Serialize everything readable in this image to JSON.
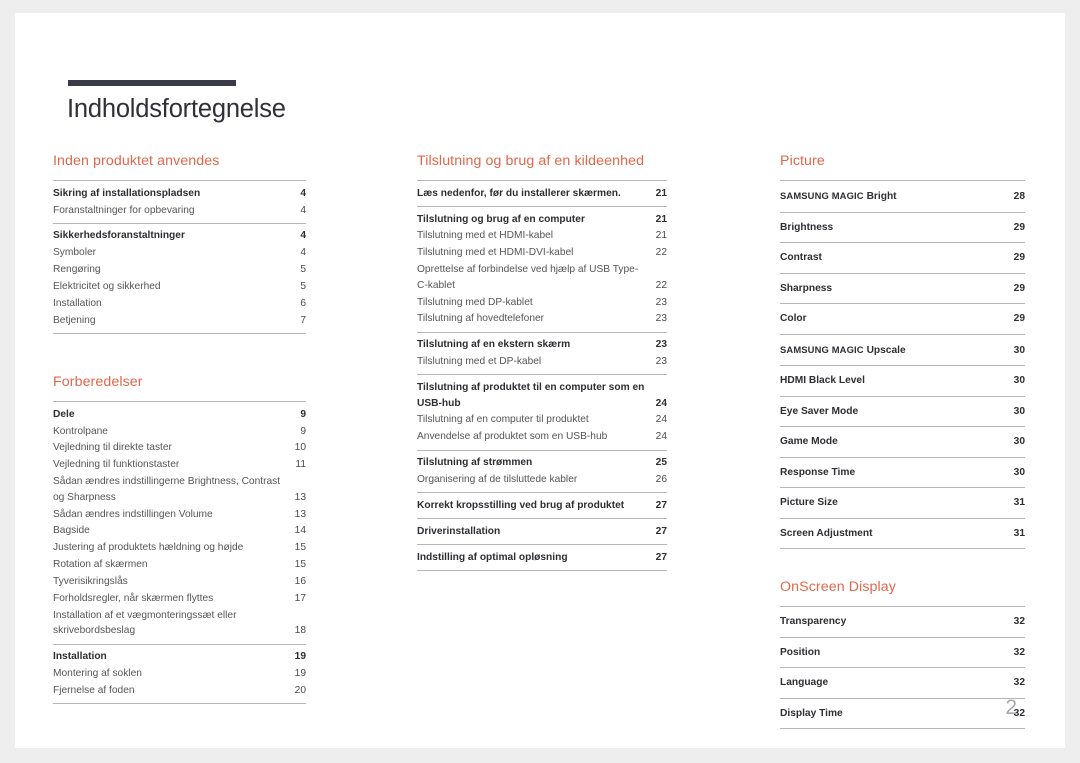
{
  "document": {
    "title": "Indholdsfortegnelse",
    "page_number": "2",
    "accent_color": "#e2674a",
    "rule_color": "#3b3b47"
  },
  "columns": [
    {
      "sections": [
        {
          "heading": "Inden produktet anvendes",
          "groups": [
            {
              "entries": [
                {
                  "label": "Sikring af installationspladsen",
                  "page": "4",
                  "level": 1
                },
                {
                  "label": "Foranstaltninger for opbevaring",
                  "page": "4",
                  "level": 2
                }
              ]
            },
            {
              "entries": [
                {
                  "label": "Sikkerhedsforanstaltninger",
                  "page": "4",
                  "level": 1
                },
                {
                  "label": "Symboler",
                  "page": "4",
                  "level": 2
                },
                {
                  "label": "Rengøring",
                  "page": "5",
                  "level": 2
                },
                {
                  "label": "Elektricitet og sikkerhed",
                  "page": "5",
                  "level": 2
                },
                {
                  "label": "Installation",
                  "page": "6",
                  "level": 2
                },
                {
                  "label": "Betjening",
                  "page": "7",
                  "level": 2
                }
              ]
            }
          ]
        },
        {
          "heading": "Forberedelser",
          "groups": [
            {
              "entries": [
                {
                  "label": "Dele",
                  "page": "9",
                  "level": 1
                },
                {
                  "label": "Kontrolpane",
                  "page": "9",
                  "level": 2
                },
                {
                  "label": "Vejledning til direkte taster",
                  "page": "10",
                  "level": 2
                },
                {
                  "label": "Vejledning til funktionstaster",
                  "page": "11",
                  "level": 2
                },
                {
                  "label": "Sådan ændres indstillingerne Brightness, Contrast og Sharpness",
                  "page": "13",
                  "level": 2
                },
                {
                  "label": "Sådan ændres indstillingen Volume",
                  "page": "13",
                  "level": 2
                },
                {
                  "label": "Bagside",
                  "page": "14",
                  "level": 2
                },
                {
                  "label": "Justering af produktets hældning og højde",
                  "page": "15",
                  "level": 2
                },
                {
                  "label": "Rotation af skærmen",
                  "page": "15",
                  "level": 2
                },
                {
                  "label": "Tyverisikringslås",
                  "page": "16",
                  "level": 2
                },
                {
                  "label": "Forholdsregler, når skærmen flyttes",
                  "page": "17",
                  "level": 2
                },
                {
                  "label": "Installation af et vægmonteringssæt eller skrivebordsbeslag",
                  "page": "18",
                  "level": 2
                }
              ]
            },
            {
              "entries": [
                {
                  "label": "Installation",
                  "page": "19",
                  "level": 1
                },
                {
                  "label": "Montering af soklen",
                  "page": "19",
                  "level": 2
                },
                {
                  "label": "Fjernelse af foden",
                  "page": "20",
                  "level": 2
                }
              ]
            }
          ]
        }
      ]
    },
    {
      "sections": [
        {
          "heading": "Tilslutning og brug af en kildeenhed",
          "groups": [
            {
              "entries": [
                {
                  "label": "Læs nedenfor, før du installerer skærmen.",
                  "page": "21",
                  "level": 1
                }
              ]
            },
            {
              "entries": [
                {
                  "label": "Tilslutning og brug af en computer",
                  "page": "21",
                  "level": 1
                },
                {
                  "label": "Tilslutning med et HDMI-kabel",
                  "page": "21",
                  "level": 2
                },
                {
                  "label": "Tilslutning med et HDMI-DVI-kabel",
                  "page": "22",
                  "level": 2
                },
                {
                  "label": "Oprettelse af forbindelse ved hjælp af USB Type-C-kablet",
                  "page": "22",
                  "level": 2
                },
                {
                  "label": "Tilslutning med DP-kablet",
                  "page": "23",
                  "level": 2
                },
                {
                  "label": "Tilslutning af hovedtelefoner",
                  "page": "23",
                  "level": 2
                }
              ]
            },
            {
              "entries": [
                {
                  "label": "Tilslutning af en ekstern skærm",
                  "page": "23",
                  "level": 1
                },
                {
                  "label": "Tilslutning med et DP-kabel",
                  "page": "23",
                  "level": 2
                }
              ]
            },
            {
              "entries": [
                {
                  "label": "Tilslutning af produktet til en computer som en USB-hub",
                  "page": "24",
                  "level": 1
                },
                {
                  "label": "Tilslutning af en computer til produktet",
                  "page": "24",
                  "level": 2
                },
                {
                  "label": "Anvendelse af produktet som en USB-hub",
                  "page": "24",
                  "level": 2
                }
              ]
            },
            {
              "entries": [
                {
                  "label": "Tilslutning af strømmen",
                  "page": "25",
                  "level": 1
                },
                {
                  "label": "Organisering af de tilsluttede kabler",
                  "page": "26",
                  "level": 2
                }
              ]
            },
            {
              "entries": [
                {
                  "label": "Korrekt kropsstilling ved brug af produktet",
                  "page": "27",
                  "level": 1
                }
              ]
            },
            {
              "entries": [
                {
                  "label": "Driverinstallation",
                  "page": "27",
                  "level": 1
                }
              ]
            },
            {
              "entries": [
                {
                  "label": "Indstilling af optimal opløsning",
                  "page": "27",
                  "level": 1
                }
              ]
            }
          ]
        }
      ]
    },
    {
      "sections": [
        {
          "heading": "Picture",
          "style": "spaced",
          "groups": [
            {
              "entries": [
                {
                  "label": "SAMSUNG MAGIC Bright",
                  "page": "28",
                  "level": 1,
                  "smallcaps_prefix": "SAMSUNG MAGIC",
                  "rest": " Bright"
                },
                {
                  "label": "Brightness",
                  "page": "29",
                  "level": 1
                },
                {
                  "label": "Contrast",
                  "page": "29",
                  "level": 1
                },
                {
                  "label": "Sharpness",
                  "page": "29",
                  "level": 1
                },
                {
                  "label": "Color",
                  "page": "29",
                  "level": 1
                },
                {
                  "label": "SAMSUNG MAGIC Upscale",
                  "page": "30",
                  "level": 1,
                  "smallcaps_prefix": "SAMSUNG MAGIC",
                  "rest": " Upscale"
                },
                {
                  "label": "HDMI Black Level",
                  "page": "30",
                  "level": 1
                },
                {
                  "label": "Eye Saver Mode",
                  "page": "30",
                  "level": 1
                },
                {
                  "label": "Game Mode",
                  "page": "30",
                  "level": 1
                },
                {
                  "label": "Response Time",
                  "page": "30",
                  "level": 1
                },
                {
                  "label": "Picture Size",
                  "page": "31",
                  "level": 1
                },
                {
                  "label": "Screen Adjustment",
                  "page": "31",
                  "level": 1
                }
              ]
            }
          ]
        },
        {
          "heading": "OnScreen Display",
          "style": "spaced",
          "groups": [
            {
              "entries": [
                {
                  "label": "Transparency",
                  "page": "32",
                  "level": 1
                },
                {
                  "label": "Position",
                  "page": "32",
                  "level": 1
                },
                {
                  "label": "Language",
                  "page": "32",
                  "level": 1
                },
                {
                  "label": "Display Time",
                  "page": "32",
                  "level": 1
                }
              ]
            }
          ]
        }
      ]
    }
  ]
}
